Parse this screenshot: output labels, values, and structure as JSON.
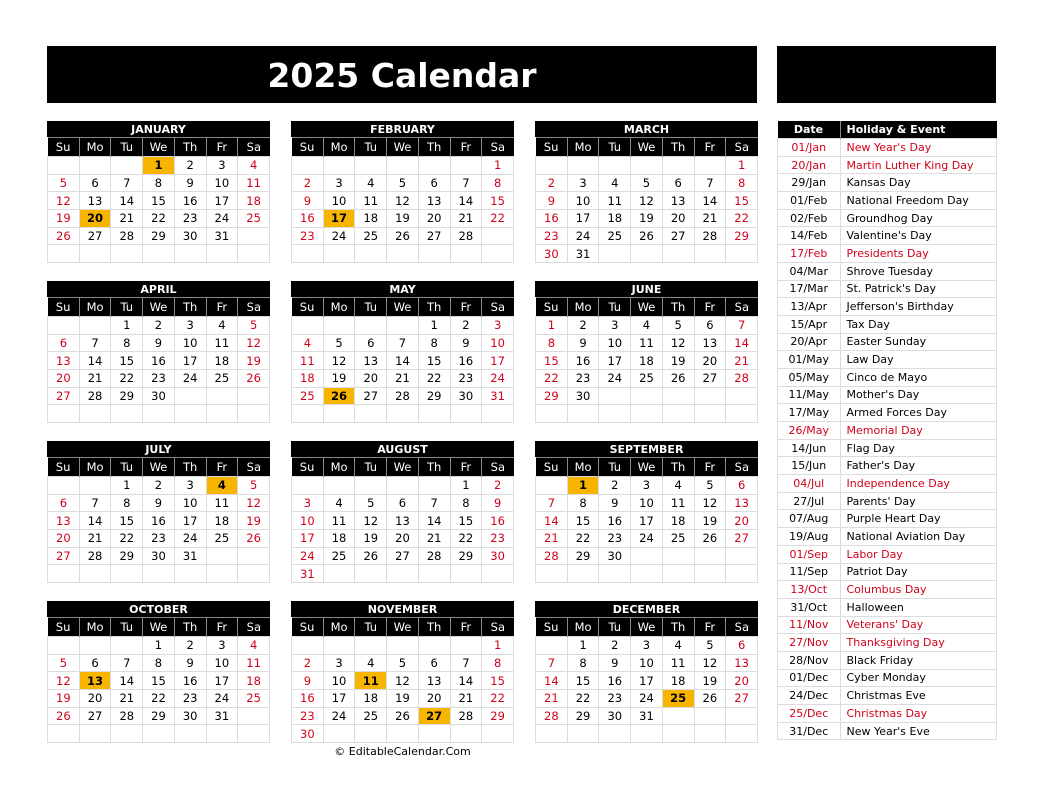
{
  "title": "2025 Calendar",
  "footer": "© EditableCalendar.Com",
  "colors": {
    "highlight": "#f7b500",
    "weekend": "#d0021b",
    "header_bg": "#000000"
  },
  "weekdays": [
    "Su",
    "Mo",
    "Tu",
    "We",
    "Th",
    "Fr",
    "Sa"
  ],
  "months": [
    {
      "name": "JANUARY",
      "start": 3,
      "days": 31,
      "highlights": [
        1,
        20
      ]
    },
    {
      "name": "FEBRUARY",
      "start": 6,
      "days": 28,
      "highlights": [
        17
      ]
    },
    {
      "name": "MARCH",
      "start": 6,
      "days": 31,
      "highlights": []
    },
    {
      "name": "APRIL",
      "start": 2,
      "days": 30,
      "highlights": []
    },
    {
      "name": "MAY",
      "start": 4,
      "days": 31,
      "highlights": [
        26
      ]
    },
    {
      "name": "JUNE",
      "start": 0,
      "days": 30,
      "highlights": []
    },
    {
      "name": "JULY",
      "start": 2,
      "days": 31,
      "highlights": [
        4
      ]
    },
    {
      "name": "AUGUST",
      "start": 5,
      "days": 31,
      "highlights": []
    },
    {
      "name": "SEPTEMBER",
      "start": 1,
      "days": 30,
      "highlights": [
        1
      ]
    },
    {
      "name": "OCTOBER",
      "start": 3,
      "days": 31,
      "highlights": [
        13
      ]
    },
    {
      "name": "NOVEMBER",
      "start": 6,
      "days": 30,
      "highlights": [
        11,
        27
      ]
    },
    {
      "name": "DECEMBER",
      "start": 1,
      "days": 31,
      "highlights": [
        25
      ]
    }
  ],
  "holidays": {
    "header": {
      "date": "Date",
      "name": "Holiday & Event"
    },
    "rows": [
      {
        "date": "01/Jan",
        "name": "New Year's Day",
        "federal": true
      },
      {
        "date": "20/Jan",
        "name": "Martin Luther King Day",
        "federal": true
      },
      {
        "date": "29/Jan",
        "name": "Kansas Day",
        "federal": false
      },
      {
        "date": "01/Feb",
        "name": "National Freedom Day",
        "federal": false
      },
      {
        "date": "02/Feb",
        "name": "Groundhog Day",
        "federal": false
      },
      {
        "date": "14/Feb",
        "name": "Valentine's Day",
        "federal": false
      },
      {
        "date": "17/Feb",
        "name": "Presidents Day",
        "federal": true
      },
      {
        "date": "04/Mar",
        "name": "Shrove Tuesday",
        "federal": false
      },
      {
        "date": "17/Mar",
        "name": "St. Patrick's Day",
        "federal": false
      },
      {
        "date": "13/Apr",
        "name": "Jefferson's Birthday",
        "federal": false
      },
      {
        "date": "15/Apr",
        "name": "Tax Day",
        "federal": false
      },
      {
        "date": "20/Apr",
        "name": "Easter Sunday",
        "federal": false
      },
      {
        "date": "01/May",
        "name": "Law Day",
        "federal": false
      },
      {
        "date": "05/May",
        "name": "Cinco de Mayo",
        "federal": false
      },
      {
        "date": "11/May",
        "name": "Mother's Day",
        "federal": false
      },
      {
        "date": "17/May",
        "name": "Armed Forces Day",
        "federal": false
      },
      {
        "date": "26/May",
        "name": "Memorial Day",
        "federal": true
      },
      {
        "date": "14/Jun",
        "name": "Flag Day",
        "federal": false
      },
      {
        "date": "15/Jun",
        "name": "Father's Day",
        "federal": false
      },
      {
        "date": "04/Jul",
        "name": "Independence Day",
        "federal": true
      },
      {
        "date": "27/Jul",
        "name": "Parents' Day",
        "federal": false
      },
      {
        "date": "07/Aug",
        "name": "Purple Heart Day",
        "federal": false
      },
      {
        "date": "19/Aug",
        "name": "National Aviation Day",
        "federal": false
      },
      {
        "date": "01/Sep",
        "name": "Labor Day",
        "federal": true
      },
      {
        "date": "11/Sep",
        "name": "Patriot Day",
        "federal": false
      },
      {
        "date": "13/Oct",
        "name": "Columbus Day",
        "federal": true
      },
      {
        "date": "31/Oct",
        "name": "Halloween",
        "federal": false
      },
      {
        "date": "11/Nov",
        "name": "Veterans' Day",
        "federal": true
      },
      {
        "date": "27/Nov",
        "name": "Thanksgiving Day",
        "federal": true
      },
      {
        "date": "28/Nov",
        "name": "Black Friday",
        "federal": false
      },
      {
        "date": "01/Dec",
        "name": "Cyber Monday",
        "federal": false
      },
      {
        "date": "24/Dec",
        "name": "Christmas Eve",
        "federal": false
      },
      {
        "date": "25/Dec",
        "name": "Christmas Day",
        "federal": true
      },
      {
        "date": "31/Dec",
        "name": "New Year's Eve",
        "federal": false
      }
    ]
  }
}
